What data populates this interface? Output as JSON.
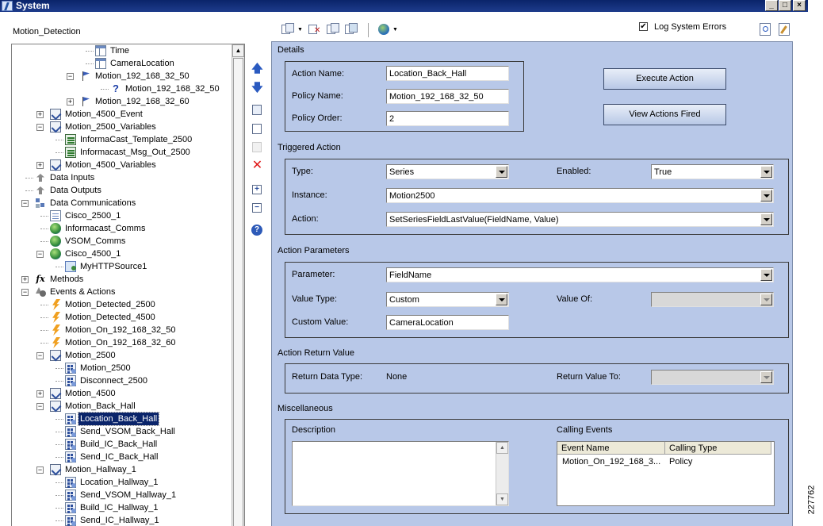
{
  "window": {
    "title": "System"
  },
  "left_panel": {
    "label": "Motion_Detection"
  },
  "tree": [
    {
      "label": "Time",
      "icon": "table-icon",
      "indent": 5,
      "expander": "",
      "selected": false
    },
    {
      "label": "CameraLocation",
      "icon": "table-icon",
      "indent": 5,
      "expander": "",
      "selected": false
    },
    {
      "label": "Motion_192_168_32_50",
      "icon": "flag-icon",
      "indent": 4,
      "expander": "-",
      "selected": false
    },
    {
      "label": "Motion_192_168_32_50",
      "icon": "question-icon",
      "indent": 6,
      "expander": "",
      "selected": false
    },
    {
      "label": "Motion_192_168_32_60",
      "icon": "flag-icon",
      "indent": 4,
      "expander": "+",
      "selected": false
    },
    {
      "label": "Motion_4500_Event",
      "icon": "event-icon",
      "indent": 2,
      "expander": "+",
      "selected": false
    },
    {
      "label": "Motion_2500_Variables",
      "icon": "event-icon",
      "indent": 2,
      "expander": "-",
      "selected": false
    },
    {
      "label": "InformaCast_Template_2500",
      "icon": "variable-icon",
      "indent": 3,
      "expander": "",
      "selected": false
    },
    {
      "label": "Informacast_Msg_Out_2500",
      "icon": "variable-icon",
      "indent": 3,
      "expander": "",
      "selected": false
    },
    {
      "label": "Motion_4500_Variables",
      "icon": "event-icon",
      "indent": 2,
      "expander": "+",
      "selected": false
    },
    {
      "label": "Data Inputs",
      "icon": "data-inputs-icon",
      "indent": 1,
      "expander": "",
      "selected": false
    },
    {
      "label": "Data Outputs",
      "icon": "data-outputs-icon",
      "indent": 1,
      "expander": "",
      "selected": false
    },
    {
      "label": "Data Communications",
      "icon": "communications-icon",
      "indent": 1,
      "expander": "-",
      "selected": false
    },
    {
      "label": "Cisco_2500_1",
      "icon": "page-icon",
      "indent": 2,
      "expander": "",
      "selected": false
    },
    {
      "label": "Informacast_Comms",
      "icon": "globe-icon",
      "indent": 2,
      "expander": "",
      "selected": false
    },
    {
      "label": "VSOM_Comms",
      "icon": "globe-icon",
      "indent": 2,
      "expander": "",
      "selected": false
    },
    {
      "label": "Cisco_4500_1",
      "icon": "globe-icon",
      "indent": 2,
      "expander": "-",
      "selected": false
    },
    {
      "label": "MyHTTPSource1",
      "icon": "http-source-icon",
      "indent": 3,
      "expander": "",
      "selected": false
    },
    {
      "label": "Methods",
      "icon": "function-icon",
      "indent": 1,
      "expander": "+",
      "selected": false
    },
    {
      "label": "Events & Actions",
      "icon": "events-actions-icon",
      "indent": 1,
      "expander": "-",
      "selected": false
    },
    {
      "label": "Motion_Detected_2500",
      "icon": "lightning-icon",
      "indent": 2,
      "expander": "",
      "selected": false
    },
    {
      "label": "Motion_Detected_4500",
      "icon": "lightning-icon",
      "indent": 2,
      "expander": "",
      "selected": false
    },
    {
      "label": "Motion_On_192_168_32_50",
      "icon": "lightning-icon",
      "indent": 2,
      "expander": "",
      "selected": false
    },
    {
      "label": "Motion_On_192_168_32_60",
      "icon": "lightning-icon",
      "indent": 2,
      "expander": "",
      "selected": false
    },
    {
      "label": "Motion_2500",
      "icon": "event-icon",
      "indent": 2,
      "expander": "-",
      "selected": false
    },
    {
      "label": "Motion_2500",
      "icon": "action-icon",
      "indent": 3,
      "expander": "",
      "selected": false
    },
    {
      "label": "Disconnect_2500",
      "icon": "action-icon",
      "indent": 3,
      "expander": "",
      "selected": false
    },
    {
      "label": "Motion_4500",
      "icon": "event-icon",
      "indent": 2,
      "expander": "+",
      "selected": false
    },
    {
      "label": "Motion_Back_Hall",
      "icon": "event-icon",
      "indent": 2,
      "expander": "-",
      "selected": false
    },
    {
      "label": "Location_Back_Hall",
      "icon": "action-icon",
      "indent": 3,
      "expander": "",
      "selected": true
    },
    {
      "label": "Send_VSOM_Back_Hall",
      "icon": "action-icon",
      "indent": 3,
      "expander": "",
      "selected": false
    },
    {
      "label": "Build_IC_Back_Hall",
      "icon": "action-icon",
      "indent": 3,
      "expander": "",
      "selected": false
    },
    {
      "label": "Send_IC_Back_Hall",
      "icon": "action-icon",
      "indent": 3,
      "expander": "",
      "selected": false
    },
    {
      "label": "Motion_Hallway_1",
      "icon": "event-icon",
      "indent": 2,
      "expander": "-",
      "selected": false
    },
    {
      "label": "Location_Hallway_1",
      "icon": "action-icon",
      "indent": 3,
      "expander": "",
      "selected": false
    },
    {
      "label": "Send_VSOM_Hallway_1",
      "icon": "action-icon",
      "indent": 3,
      "expander": "",
      "selected": false
    },
    {
      "label": "Build_IC_Hallway_1",
      "icon": "action-icon",
      "indent": 3,
      "expander": "",
      "selected": false
    },
    {
      "label": "Send_IC_Hallway_1",
      "icon": "action-icon",
      "indent": 3,
      "expander": "",
      "selected": false
    }
  ],
  "toolbar": {
    "log_system_errors_label": "Log System Errors",
    "log_system_errors_checked": true
  },
  "details": {
    "section_label": "Details",
    "action_name_label": "Action Name:",
    "action_name_value": "Location_Back_Hall",
    "policy_name_label": "Policy Name:",
    "policy_name_value": "Motion_192_168_32_50",
    "policy_order_label": "Policy Order:",
    "policy_order_value": "2",
    "execute_action_button": "Execute Action",
    "view_actions_fired_button": "View Actions Fired"
  },
  "triggered_action": {
    "section_label": "Triggered Action",
    "type_label": "Type:",
    "type_value": "Series",
    "enabled_label": "Enabled:",
    "enabled_value": "True",
    "instance_label": "Instance:",
    "instance_value": "Motion2500",
    "action_label": "Action:",
    "action_value": "SetSeriesFieldLastValue(FieldName, Value)"
  },
  "action_parameters": {
    "section_label": "Action Parameters",
    "parameter_label": "Parameter:",
    "parameter_value": "FieldName",
    "value_type_label": "Value Type:",
    "value_type_value": "Custom",
    "value_of_label": "Value Of:",
    "value_of_value": "",
    "custom_value_label": "Custom Value:",
    "custom_value_value": "CameraLocation"
  },
  "action_return_value": {
    "section_label": "Action Return Value",
    "return_data_type_label": "Return Data Type:",
    "return_data_type_value": "None",
    "return_value_to_label": "Return Value To:",
    "return_value_to_value": ""
  },
  "miscellaneous": {
    "section_label": "Miscellaneous",
    "description_label": "Description",
    "description_value": "",
    "calling_events_label": "Calling Events",
    "calling_events_columns": [
      "Event Name",
      "Calling Type"
    ],
    "calling_events_rows": [
      [
        "Motion_On_192_168_3...",
        "Policy"
      ]
    ]
  },
  "figure_id": "227762"
}
